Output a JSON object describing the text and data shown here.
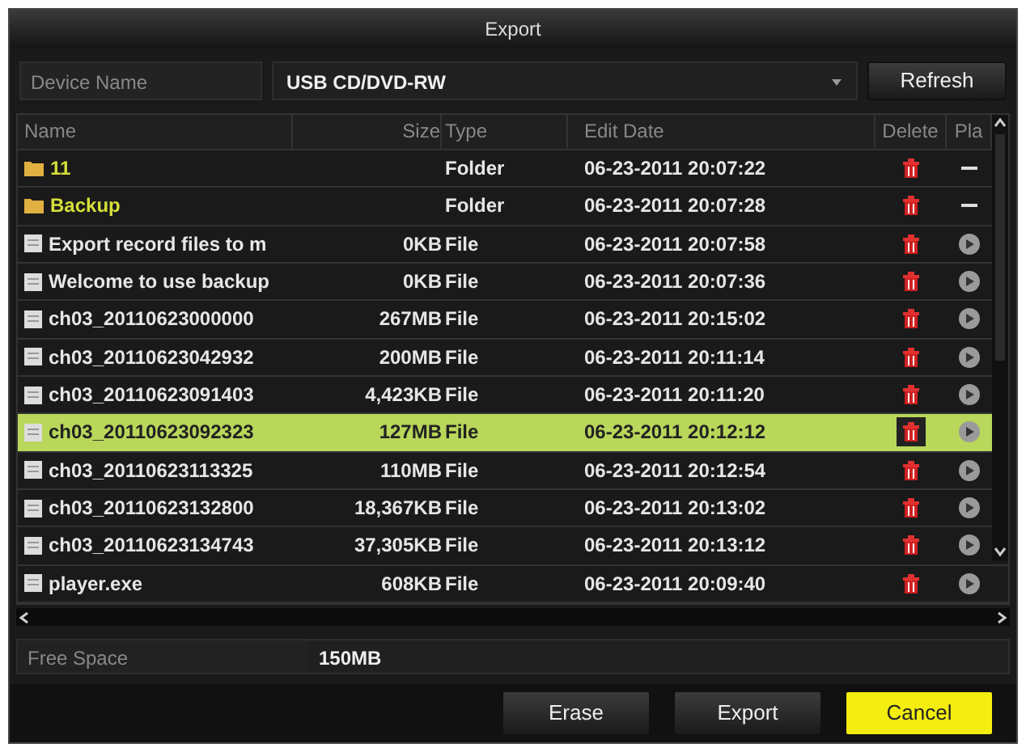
{
  "window": {
    "title": "Export"
  },
  "device": {
    "label": "Device Name",
    "value": "USB CD/DVD-RW",
    "button": "Refresh"
  },
  "table": {
    "columns": [
      "Name",
      "Size",
      "Type",
      "Edit Date",
      "Delete",
      "Pla"
    ],
    "rows": [
      {
        "kind": "folder",
        "name": "11",
        "size": "",
        "type": "Folder",
        "date": "06-23-2011 20:07:22",
        "selected": false
      },
      {
        "kind": "folder",
        "name": "Backup",
        "size": "",
        "type": "Folder",
        "date": "06-23-2011 20:07:28",
        "selected": false
      },
      {
        "kind": "file",
        "name": "Export record files to m",
        "size": "0KB",
        "type": "File",
        "date": "06-23-2011 20:07:58",
        "selected": false
      },
      {
        "kind": "file",
        "name": "Welcome to use backup",
        "size": "0KB",
        "type": "File",
        "date": "06-23-2011 20:07:36",
        "selected": false
      },
      {
        "kind": "file",
        "name": "ch03_20110623000000",
        "size": "267MB",
        "type": "File",
        "date": "06-23-2011 20:15:02",
        "selected": false
      },
      {
        "kind": "file",
        "name": "ch03_20110623042932",
        "size": "200MB",
        "type": "File",
        "date": "06-23-2011 20:11:14",
        "selected": false
      },
      {
        "kind": "file",
        "name": "ch03_20110623091403",
        "size": "4,423KB",
        "type": "File",
        "date": "06-23-2011 20:11:20",
        "selected": false
      },
      {
        "kind": "file",
        "name": "ch03_20110623092323",
        "size": "127MB",
        "type": "File",
        "date": "06-23-2011 20:12:12",
        "selected": true
      },
      {
        "kind": "file",
        "name": "ch03_20110623113325",
        "size": "110MB",
        "type": "File",
        "date": "06-23-2011 20:12:54",
        "selected": false
      },
      {
        "kind": "file",
        "name": "ch03_20110623132800",
        "size": "18,367KB",
        "type": "File",
        "date": "06-23-2011 20:13:02",
        "selected": false
      },
      {
        "kind": "file",
        "name": "ch03_20110623134743",
        "size": "37,305KB",
        "type": "File",
        "date": "06-23-2011 20:13:12",
        "selected": false
      },
      {
        "kind": "file",
        "name": "player.exe",
        "size": "608KB",
        "type": "File",
        "date": "06-23-2011 20:09:40",
        "selected": false
      }
    ]
  },
  "free_space": {
    "label": "Free Space",
    "value": "150MB"
  },
  "buttons": [
    "Erase",
    "Export",
    "Cancel"
  ]
}
